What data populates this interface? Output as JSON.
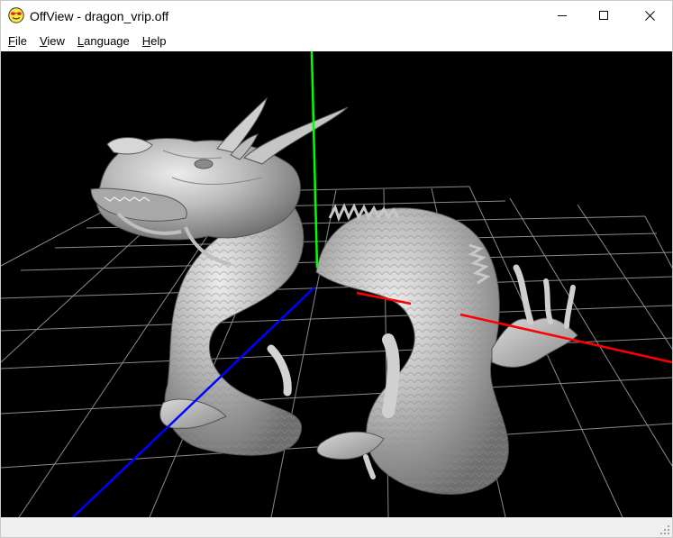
{
  "window": {
    "title": "OffView - dragon_vrip.off",
    "icon": "smiley-sunglasses-icon"
  },
  "window_controls": {
    "minimize_icon": "minimize-icon",
    "maximize_icon": "maximize-icon",
    "close_icon": "close-icon"
  },
  "menu": {
    "items": [
      {
        "label": "File",
        "accel": "F",
        "rest": "ile"
      },
      {
        "label": "View",
        "accel": "V",
        "rest": "iew"
      },
      {
        "label": "Language",
        "accel": "L",
        "rest": "anguage"
      },
      {
        "label": "Help",
        "accel": "H",
        "rest": "elp"
      }
    ]
  },
  "viewport": {
    "model": "dragon",
    "background": "#000000",
    "grid_color": "#8a8a8a",
    "axis_colors": {
      "x": "#ff0000",
      "y": "#00ff00",
      "z": "#0000ff"
    },
    "model_color": "#bdbdbd"
  },
  "statusbar": {
    "text": ""
  }
}
